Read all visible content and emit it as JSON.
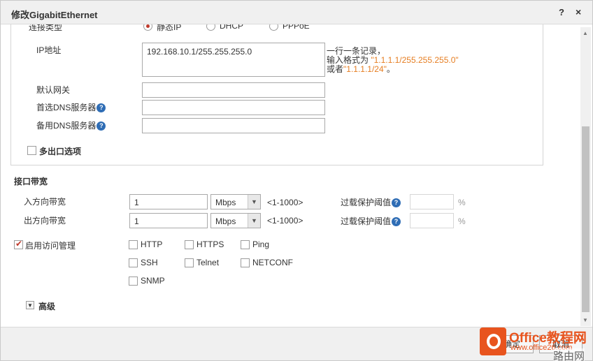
{
  "dialog": {
    "title": "修改GigabitEthernet",
    "help": "?",
    "close": "×"
  },
  "connection": {
    "label": "连接类型",
    "options": [
      "静态IP",
      "DHCP",
      "PPPoE"
    ],
    "selected": "静态IP"
  },
  "ip": {
    "label": "IP地址",
    "value": "192.168.10.1/255.255.255.0",
    "hint_line1": "一行一条记录，",
    "hint_line2_prefix": "输入格式为 ",
    "hint_line2_example": "\"1.1.1.1/255.255.255.0\"",
    "hint_line3_prefix": "或者",
    "hint_line3_example": "\"1.1.1.1/24\"",
    "hint_line3_suffix": "。"
  },
  "gateway": {
    "label": "默认网关",
    "value": ""
  },
  "dns_primary": {
    "label": "首选DNS服务器",
    "value": ""
  },
  "dns_secondary": {
    "label": "备用DNS服务器",
    "value": ""
  },
  "multi_egress": {
    "label": "多出口选项",
    "checked": false
  },
  "bandwidth": {
    "title": "接口带宽",
    "inbound": {
      "label": "入方向带宽",
      "value": "1",
      "unit": "Mbps",
      "range": "<1-1000>",
      "overload_label": "过载保护阈值",
      "overload_value": "",
      "percent": "%"
    },
    "outbound": {
      "label": "出方向带宽",
      "value": "1",
      "unit": "Mbps",
      "range": "<1-1000>",
      "overload_label": "过载保护阈值",
      "overload_value": "",
      "percent": "%"
    }
  },
  "access": {
    "label": "启用访问管理",
    "checked": true,
    "protocols": [
      "HTTP",
      "HTTPS",
      "Ping",
      "SSH",
      "Telnet",
      "NETCONF",
      "SNMP"
    ]
  },
  "advanced": {
    "label": "高级"
  },
  "buttons": {
    "ok": "确定",
    "cancel": "取消"
  },
  "watermark": {
    "brand": "Office教程网",
    "url": "www.office26.com",
    "site": "路由网"
  },
  "colors": {
    "accent_red": "#c0392b",
    "help_blue": "#2f6db5",
    "hint_orange": "#e67e22",
    "watermark_orange": "#e8541e"
  }
}
